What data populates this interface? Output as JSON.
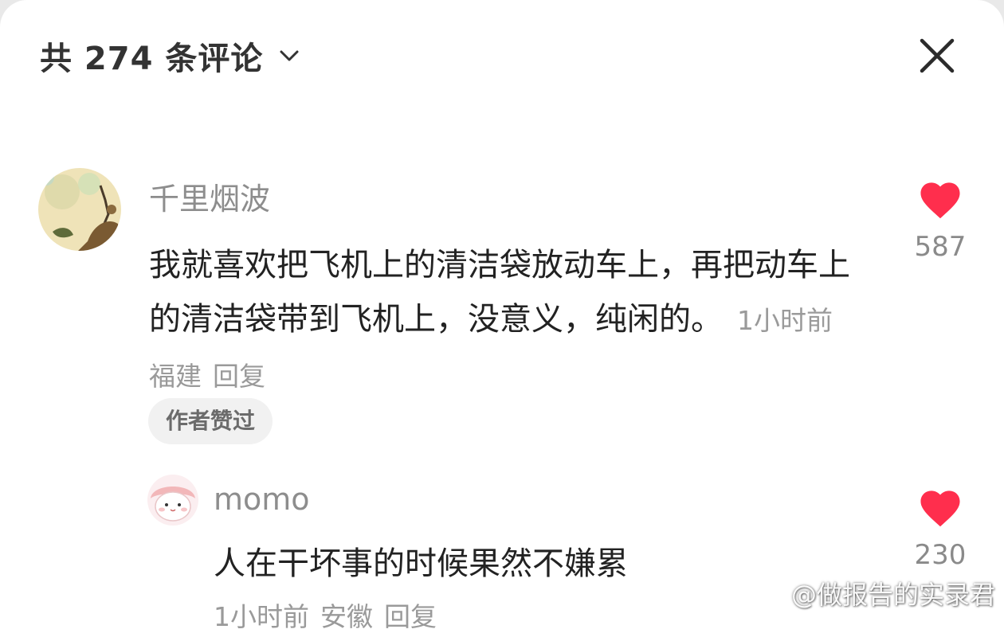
{
  "header": {
    "title": "共 274 条评论",
    "dropdown_icon": "chevron-down-icon",
    "close_icon": "close-icon"
  },
  "comment": {
    "username": "千里烟波",
    "text": "我就喜欢把飞机上的清洁袋放动车上，再把动车上的清洁袋带到飞机上，没意义，纯闲的。",
    "time": "1小时前",
    "location": "福建",
    "reply_label": "回复",
    "author_tag": "作者赞过",
    "likes": "587",
    "like_icon": "heart-icon"
  },
  "reply": {
    "username": "momo",
    "text": "人在干坏事的时候果然不嫌累",
    "time": "1小时前",
    "location": "安徽",
    "reply_label": "回复",
    "likes": "230",
    "like_icon": "heart-icon"
  },
  "watermark": {
    "text": "@做报告的实录君",
    "icon": "weibo-logo-icon"
  },
  "colors": {
    "heart": "#ff2e4d",
    "username": "#8d8d8d",
    "meta": "#9a9a9a",
    "text": "#222222"
  }
}
